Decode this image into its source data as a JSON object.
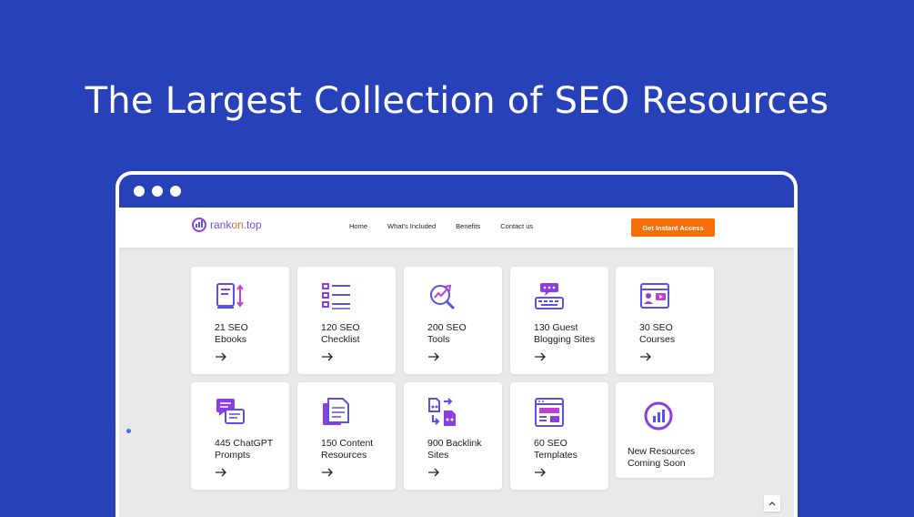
{
  "headline": "The Largest Collection of SEO Resources",
  "brand": {
    "name_prefix": "rank",
    "name_accent": "on",
    "name_suffix": ".top"
  },
  "nav": {
    "links": [
      "Home",
      "What's Included",
      "Benefits",
      "Contact us"
    ],
    "cta": "Get Instant Access"
  },
  "cards": [
    {
      "label": "21 SEO\nEbooks",
      "icon": "ebook-icon"
    },
    {
      "label": "120 SEO\nChecklist",
      "icon": "checklist-icon"
    },
    {
      "label": "200 SEO\nTools",
      "icon": "seo-tools-icon"
    },
    {
      "label": "130 Guest\nBlogging Sites",
      "icon": "guest-blogging-icon"
    },
    {
      "label": "30 SEO\nCourses",
      "icon": "courses-icon"
    },
    {
      "label": "445 ChatGPT\nPrompts",
      "icon": "chat-prompts-icon"
    },
    {
      "label": "150 Content\nResources",
      "icon": "content-resources-icon"
    },
    {
      "label": "900 Backlink\nSites",
      "icon": "backlink-icon"
    },
    {
      "label": "60 SEO\nTemplates",
      "icon": "templates-icon"
    },
    {
      "label": "New Resources\nComing Soon",
      "icon": "chart-circle-icon"
    }
  ],
  "colors": {
    "background": "#2741b8",
    "accent": "#f56e08",
    "icon_purple": "#8b3fe0",
    "icon_blue": "#5a4fe6"
  }
}
